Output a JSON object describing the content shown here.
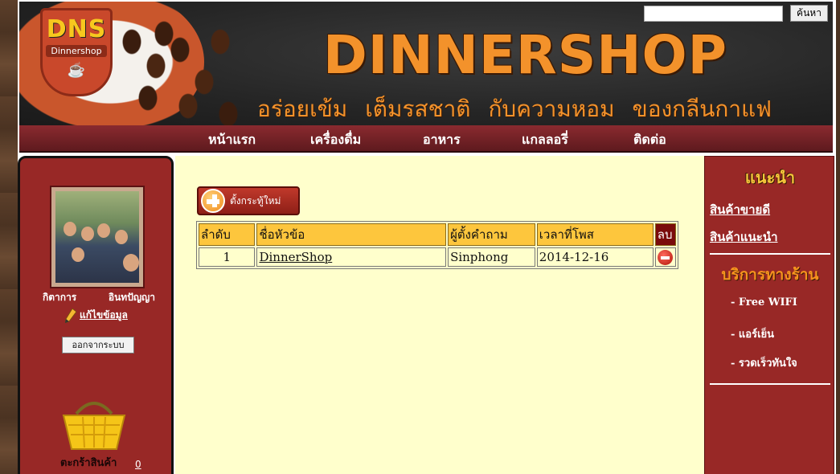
{
  "header": {
    "logo_text": "DNS",
    "logo_sub": "Dinnershop",
    "title": "DINNERSHOP",
    "slogan": [
      "อร่อยเข้ม",
      "เต็มรสชาติ",
      "กับความหอม",
      "ของกลีนกาแฟ"
    ],
    "search": {
      "value": "",
      "button": "ค้นหา"
    }
  },
  "nav": [
    "หน้าแรก",
    "เครื่องดื่ม",
    "อาหาร",
    "แกลลอรี่",
    "ติดต่อ"
  ],
  "user": {
    "first_name": "กิตาการ",
    "last_name": "อินทปัญญา",
    "edit_label": "แก้ไขข้อมูล",
    "logout_label": "ออกจากระบบ",
    "cart_label": "ตะกร้าสินค้า",
    "cart_count": "0"
  },
  "forum": {
    "new_topic_label": "ตั้งกระทู้ใหม่",
    "columns": [
      "ลำดับ",
      "ชื่อหัวข้อ",
      "ผู้ตั้งคำถาม",
      "เวลาที่โพส",
      "ลบ"
    ],
    "rows": [
      {
        "no": "1",
        "title": "DinnerShop",
        "author": "Sinphong",
        "date": "2014-12-16"
      }
    ]
  },
  "sidebar": {
    "recommend_title": "แนะนำ",
    "links": [
      "สินค้าขายดี",
      "สินค้าแนะนำ"
    ],
    "service_title": "บริการทางร้าน",
    "services": [
      "-  Free  WIFI",
      "-  แอร์เย็น",
      "-  รวดเร็วทันใจ"
    ]
  },
  "colors": {
    "accent_orange": "#f3922b",
    "panel_red": "#982826",
    "content_bg": "#ffffcc",
    "header_cell": "#fdc63d"
  }
}
